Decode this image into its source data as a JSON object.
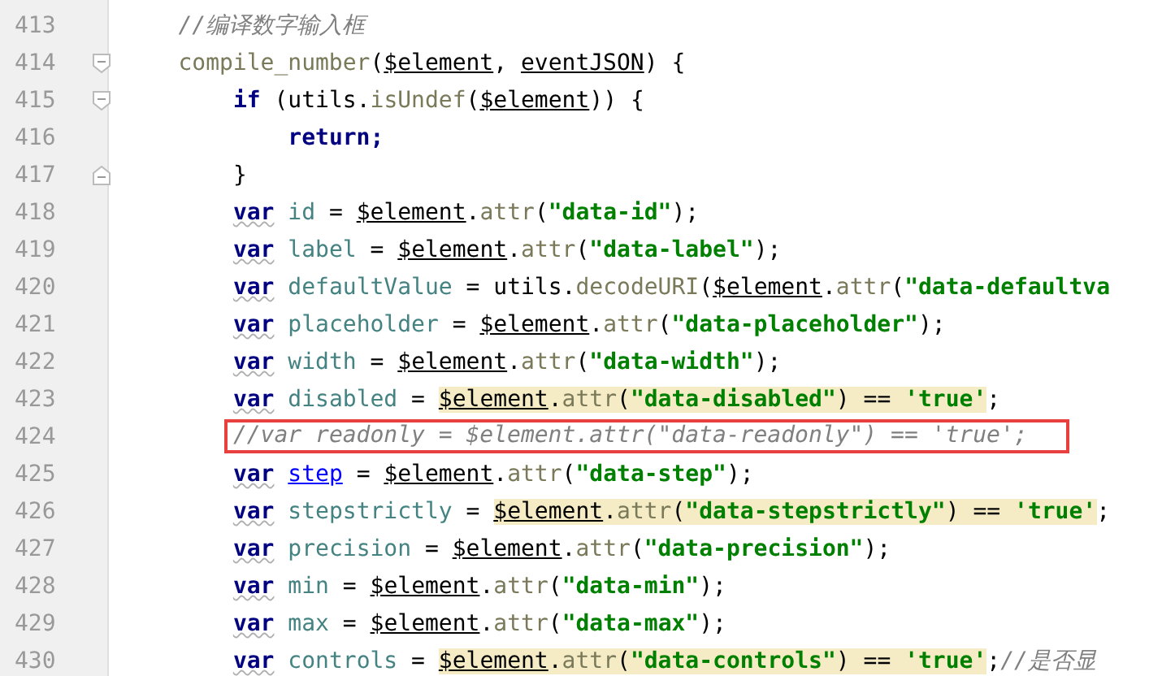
{
  "editor": {
    "lines": [
      {
        "number": "413",
        "text": "    //编译数字输入框"
      },
      {
        "number": "414",
        "text": "    compile_number($element, eventJSON) {",
        "fold_start": true
      },
      {
        "number": "415",
        "text": "        if (utils.isUndef($element)) {",
        "fold_start": true
      },
      {
        "number": "416",
        "text": "            return;"
      },
      {
        "number": "417",
        "text": "        }",
        "fold_end": true
      },
      {
        "number": "418",
        "text": "        var id = $element.attr(\"data-id\");"
      },
      {
        "number": "419",
        "text": "        var label = $element.attr(\"data-label\");"
      },
      {
        "number": "420",
        "text": "        var defaultValue = utils.decodeURI($element.attr(\"data-defaultva"
      },
      {
        "number": "421",
        "text": "        var placeholder = $element.attr(\"data-placeholder\");"
      },
      {
        "number": "422",
        "text": "        var width = $element.attr(\"data-width\");"
      },
      {
        "number": "423",
        "text": "        var disabled = $element.attr(\"data-disabled\") == 'true';",
        "highlighted": true
      },
      {
        "number": "424",
        "text": "        //var readonly = $element.attr(\"data-readonly\") == 'true';",
        "boxed": true
      },
      {
        "number": "425",
        "text": "        var step = $element.attr(\"data-step\");",
        "linked": true
      },
      {
        "number": "426",
        "text": "        var stepstrictly = $element.attr(\"data-stepstrictly\") == 'true';",
        "highlighted": true
      },
      {
        "number": "427",
        "text": "        var precision = $element.attr(\"data-precision\");"
      },
      {
        "number": "428",
        "text": "        var min = $element.attr(\"data-min\");"
      },
      {
        "number": "429",
        "text": "        var max = $element.attr(\"data-max\");"
      },
      {
        "number": "430",
        "text": "        var controls = $element.attr(\"data-controls\") == 'true';//是否显",
        "highlighted": true
      }
    ]
  }
}
